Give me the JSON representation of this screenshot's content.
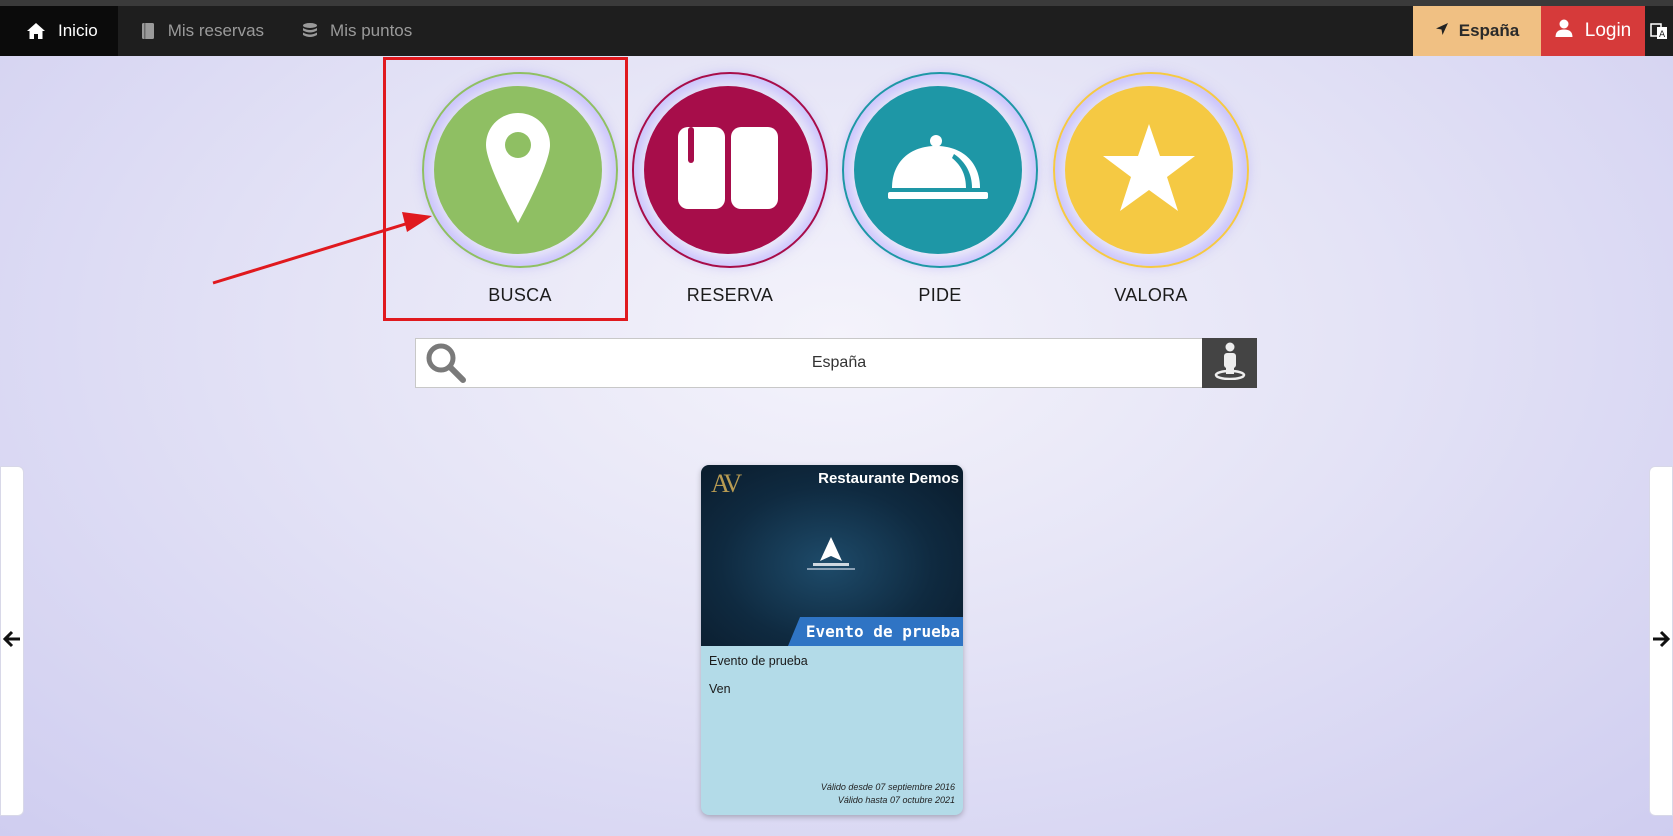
{
  "nav": {
    "home_label": "Inicio",
    "reservas_label": "Mis reservas",
    "puntos_label": "Mis puntos",
    "country_label": "España",
    "login_label": "Login"
  },
  "features": [
    {
      "label": "BUSCA",
      "color": "#8fbf63",
      "ring": "#8fbf63",
      "icon": "map-pin-icon"
    },
    {
      "label": "RESERVA",
      "color": "#a70d4a",
      "ring": "#a70d4a",
      "icon": "book-icon"
    },
    {
      "label": "PIDE",
      "color": "#1e97a6",
      "ring": "#1e97a6",
      "icon": "cloche-icon"
    },
    {
      "label": "VALORA",
      "color": "#f5c943",
      "ring": "#f5c943",
      "icon": "star-icon"
    }
  ],
  "search": {
    "value": "España",
    "placeholder": ""
  },
  "card": {
    "logo_text": "AV",
    "restaurant": "Restaurante Demos",
    "banner": "Evento de prueba",
    "title": "Evento de prueba",
    "description": "Ven",
    "valid_from": "Válido desde 07 septiembre 2016",
    "valid_to": "Válido hasta 07 octubre 2021"
  },
  "colors": {
    "highlight": "#e0191e",
    "navbar": "#1e1e1e",
    "country_button": "#f0c083",
    "login_button": "#d63a3a"
  }
}
